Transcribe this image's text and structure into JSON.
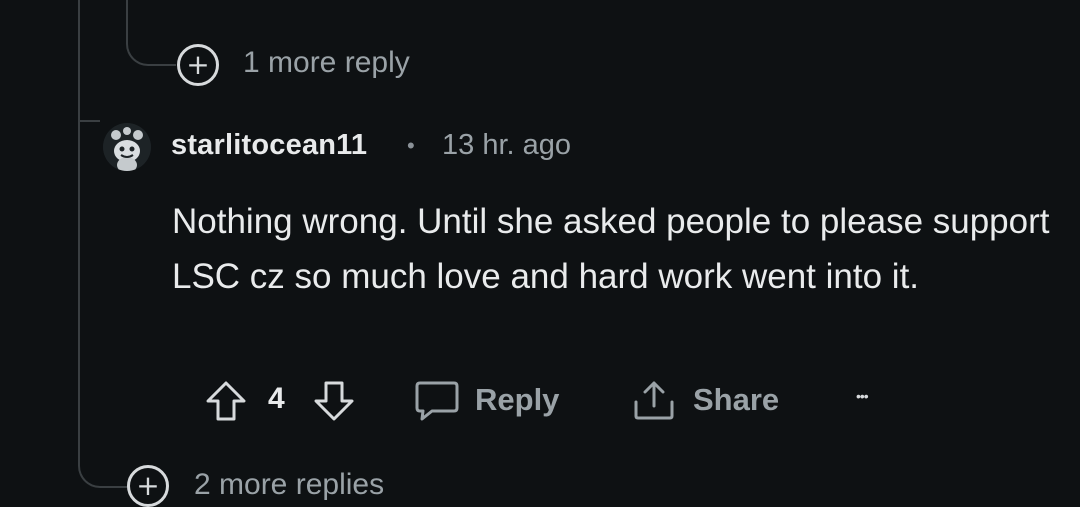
{
  "thread_above": {
    "more_replies_label": "1 more reply"
  },
  "comment": {
    "username": "starlitocean11",
    "separator": "•",
    "timestamp": "13 hr. ago",
    "body": "Nothing wrong. Until she asked people to please support LSC cz so much love and hard work went into it.",
    "vote_count": "4",
    "reply_label": "Reply",
    "share_label": "Share",
    "more_icon": "ellipsis-icon",
    "more_glyph": "•••"
  },
  "thread_below": {
    "more_replies_label": "2 more replies"
  },
  "icons": {
    "expand": "plus-circle-icon",
    "upvote": "arrow-up-icon",
    "downvote": "arrow-down-icon",
    "reply": "speech-bubble-icon",
    "share": "share-icon",
    "avatar": "snoo-avatar-icon"
  }
}
